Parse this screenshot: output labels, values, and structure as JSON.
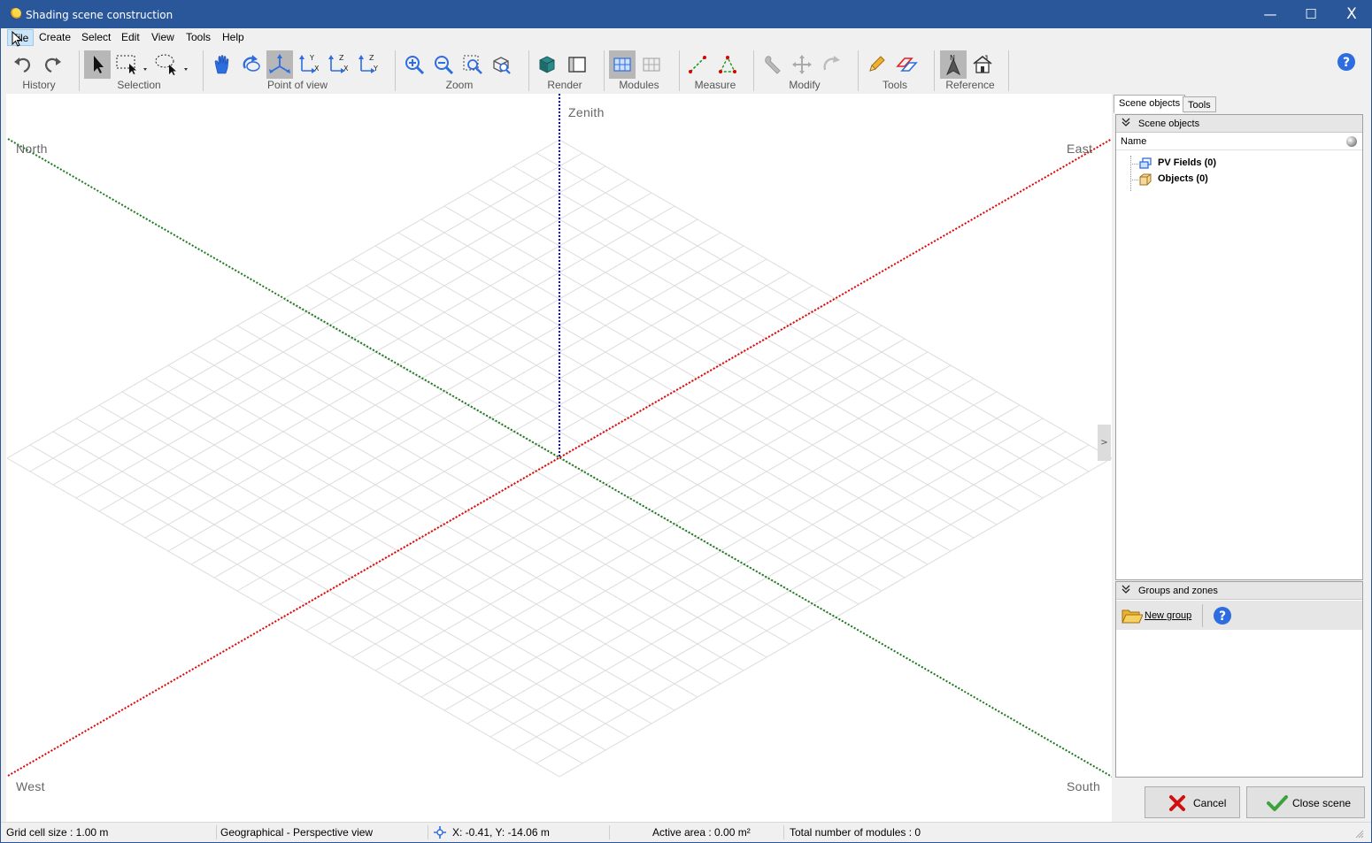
{
  "window": {
    "title": "Shading scene construction",
    "controls": {
      "minimize": "—",
      "maximize": "☐",
      "close": "X"
    }
  },
  "menu": [
    "File",
    "Create",
    "Select",
    "Edit",
    "View",
    "Tools",
    "Help"
  ],
  "toolbar": {
    "groups": [
      "History",
      "Selection",
      "Point of view",
      "Zoom",
      "Render",
      "Modules",
      "Measure",
      "Modify",
      "Tools",
      "Reference"
    ]
  },
  "viewport": {
    "axis_labels": {
      "zenith": "Zenith",
      "north": "North",
      "east": "East",
      "west": "West",
      "south": "South"
    },
    "colors": {
      "north_south_axis": "#1a7a1a",
      "east_west_axis": "#e00000",
      "zenith_axis": "#0000cc",
      "grid": "#dcdcdc"
    },
    "collapse_handle": ">"
  },
  "panel": {
    "tabs": [
      "Scene objects",
      "Tools"
    ],
    "scene_objects": {
      "header": "Scene objects",
      "column_name": "Name",
      "items": [
        "PV Fields (0)",
        "Objects (0)"
      ]
    },
    "groups": {
      "header": "Groups and zones",
      "new_group": "New group"
    },
    "buttons": {
      "cancel": "Cancel",
      "close_scene": "Close scene"
    }
  },
  "status": {
    "grid_cell": "Grid cell size :  1.00 m",
    "view_mode": "Geographical - Perspective view",
    "coords": "X: -0.41, Y: -14.06 m",
    "active_area": "Active area : 0.00 m²",
    "modules": "Total number of modules : 0"
  }
}
